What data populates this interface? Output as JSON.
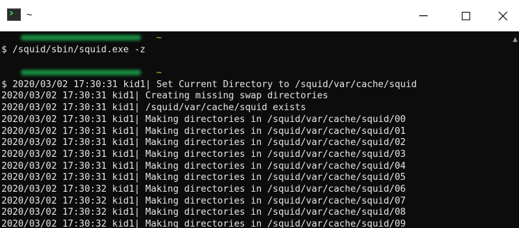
{
  "window": {
    "title": "~",
    "controls": {
      "minimize": "—",
      "maximize": "☐",
      "close": "✕"
    }
  },
  "terminal": {
    "prompt_tilde": "~",
    "command": "$ /squid/sbin/squid.exe -z",
    "lines": [
      "$ 2020/03/02 17:30:31 kid1| Set Current Directory to /squid/var/cache/squid",
      "2020/03/02 17:30:31 kid1| Creating missing swap directories",
      "2020/03/02 17:30:31 kid1| /squid/var/cache/squid exists",
      "2020/03/02 17:30:31 kid1| Making directories in /squid/var/cache/squid/00",
      "2020/03/02 17:30:31 kid1| Making directories in /squid/var/cache/squid/01",
      "2020/03/02 17:30:31 kid1| Making directories in /squid/var/cache/squid/02",
      "2020/03/02 17:30:31 kid1| Making directories in /squid/var/cache/squid/03",
      "2020/03/02 17:30:31 kid1| Making directories in /squid/var/cache/squid/04",
      "2020/03/02 17:30:31 kid1| Making directories in /squid/var/cache/squid/05",
      "2020/03/02 17:30:32 kid1| Making directories in /squid/var/cache/squid/06",
      "2020/03/02 17:30:32 kid1| Making directories in /squid/var/cache/squid/07",
      "2020/03/02 17:30:32 kid1| Making directories in /squid/var/cache/squid/08",
      "2020/03/02 17:30:32 kid1| Making directories in /squid/var/cache/squid/09"
    ]
  },
  "colors": {
    "background": "#0c0c0c",
    "text": "#e6e6e6",
    "tilde": "#c7c02a"
  },
  "icons": {
    "app": "terminal-icon",
    "scroll_up": "chevron-up-icon"
  }
}
